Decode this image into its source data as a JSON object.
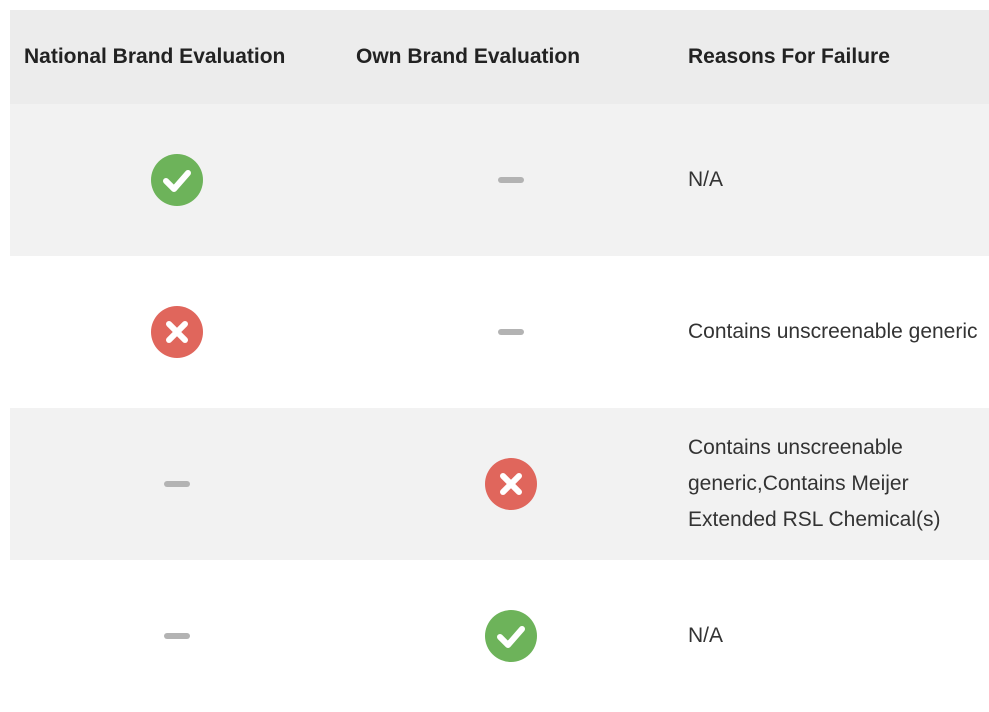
{
  "colors": {
    "header_bg": "#ececec",
    "shaded_row_bg": "#f2f2f2",
    "pass_green": "#6db35a",
    "fail_red": "#e0665c",
    "dash_gray": "#b3b3b3"
  },
  "table": {
    "headers": {
      "national": "National Brand Evaluation",
      "own": "Own Brand Evaluation",
      "reasons": "Reasons For Failure"
    },
    "rows": [
      {
        "national": "pass-icon",
        "own": "dash-icon",
        "reason": "N/A"
      },
      {
        "national": "fail-icon",
        "own": "dash-icon",
        "reason": "Contains unscreenable generic"
      },
      {
        "national": "dash-icon",
        "own": "fail-icon",
        "reason": "Contains unscreenable generic,Contains Meijer Extended RSL Chemical(s)"
      },
      {
        "national": "dash-icon",
        "own": "pass-icon",
        "reason": "N/A"
      }
    ]
  }
}
